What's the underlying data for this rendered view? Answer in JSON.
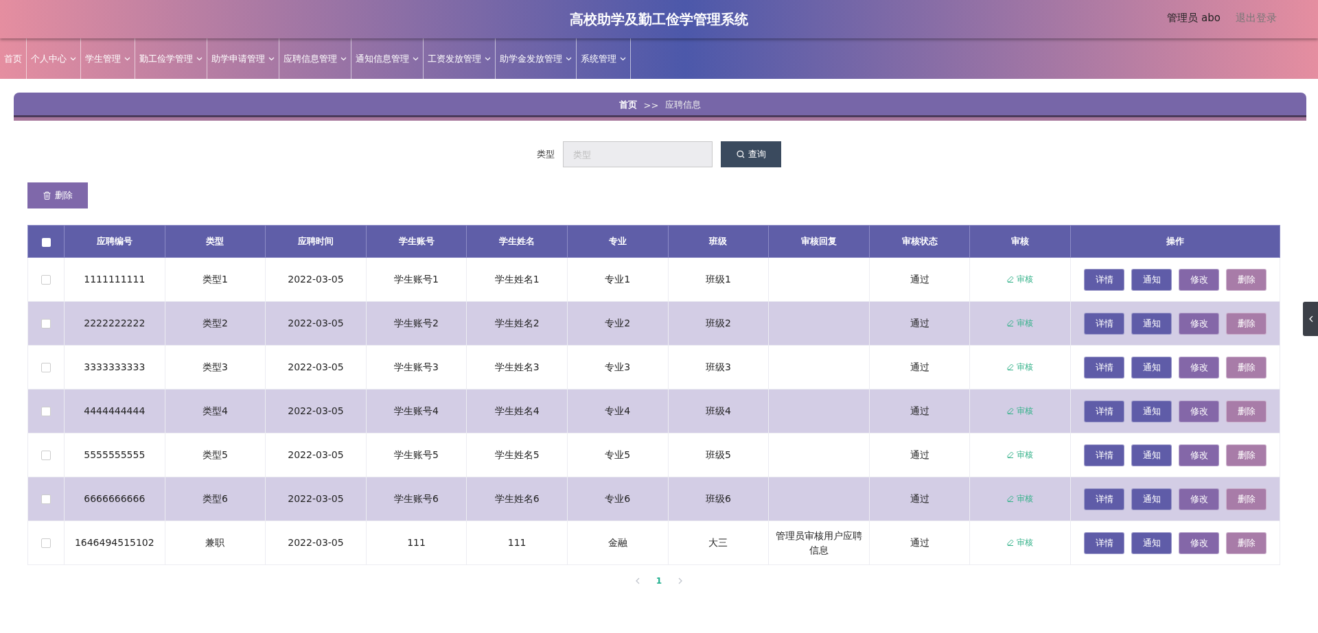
{
  "header": {
    "title": "高校助学及勤工俭学管理系统",
    "user": "管理员 abo",
    "logout": "退出登录"
  },
  "nav": [
    {
      "label": "首页",
      "has_menu": false
    },
    {
      "label": "个人中心",
      "has_menu": true
    },
    {
      "label": "学生管理",
      "has_menu": true
    },
    {
      "label": "勤工俭学管理",
      "has_menu": true
    },
    {
      "label": "助学申请管理",
      "has_menu": true
    },
    {
      "label": "应聘信息管理",
      "has_menu": true
    },
    {
      "label": "通知信息管理",
      "has_menu": true
    },
    {
      "label": "工资发放管理",
      "has_menu": true
    },
    {
      "label": "助学金发放管理",
      "has_menu": true
    },
    {
      "label": "系统管理",
      "has_menu": true
    }
  ],
  "breadcrumb": {
    "home": "首页",
    "separator": ">>",
    "current": "应聘信息"
  },
  "search": {
    "label": "类型",
    "placeholder": "类型",
    "button": "查询"
  },
  "delete_button": "删除",
  "table": {
    "header_checked": false,
    "columns": [
      "应聘编号",
      "类型",
      "应聘时间",
      "学生账号",
      "学生姓名",
      "专业",
      "班级",
      "审核回复",
      "审核状态",
      "审核",
      "操作"
    ],
    "rows": [
      {
        "checked": false,
        "cells": [
          "1111111111",
          "类型1",
          "2022-03-05",
          "学生账号1",
          "学生姓名1",
          "专业1",
          "班级1",
          "",
          "通过"
        ],
        "audit": "审核",
        "actions": [
          "详情",
          "通知",
          "修改",
          "删除"
        ]
      },
      {
        "checked": false,
        "cells": [
          "2222222222",
          "类型2",
          "2022-03-05",
          "学生账号2",
          "学生姓名2",
          "专业2",
          "班级2",
          "",
          "通过"
        ],
        "audit": "审核",
        "actions": [
          "详情",
          "通知",
          "修改",
          "删除"
        ]
      },
      {
        "checked": false,
        "cells": [
          "3333333333",
          "类型3",
          "2022-03-05",
          "学生账号3",
          "学生姓名3",
          "专业3",
          "班级3",
          "",
          "通过"
        ],
        "audit": "审核",
        "actions": [
          "详情",
          "通知",
          "修改",
          "删除"
        ]
      },
      {
        "checked": false,
        "cells": [
          "4444444444",
          "类型4",
          "2022-03-05",
          "学生账号4",
          "学生姓名4",
          "专业4",
          "班级4",
          "",
          "通过"
        ],
        "audit": "审核",
        "actions": [
          "详情",
          "通知",
          "修改",
          "删除"
        ]
      },
      {
        "checked": false,
        "cells": [
          "5555555555",
          "类型5",
          "2022-03-05",
          "学生账号5",
          "学生姓名5",
          "专业5",
          "班级5",
          "",
          "通过"
        ],
        "audit": "审核",
        "actions": [
          "详情",
          "通知",
          "修改",
          "删除"
        ]
      },
      {
        "checked": false,
        "cells": [
          "6666666666",
          "类型6",
          "2022-03-05",
          "学生账号6",
          "学生姓名6",
          "专业6",
          "班级6",
          "",
          "通过"
        ],
        "audit": "审核",
        "actions": [
          "详情",
          "通知",
          "修改",
          "删除"
        ]
      },
      {
        "checked": false,
        "cells": [
          "1646494515102",
          "兼职",
          "2022-03-05",
          "111",
          "111",
          "金融",
          "大三",
          "管理员审核用户应聘信息",
          "通过"
        ],
        "audit": "审核",
        "actions": [
          "详情",
          "通知",
          "修改",
          "删除"
        ]
      }
    ]
  },
  "pagination": {
    "pages": [
      {
        "label": "1",
        "selected": true
      }
    ]
  }
}
